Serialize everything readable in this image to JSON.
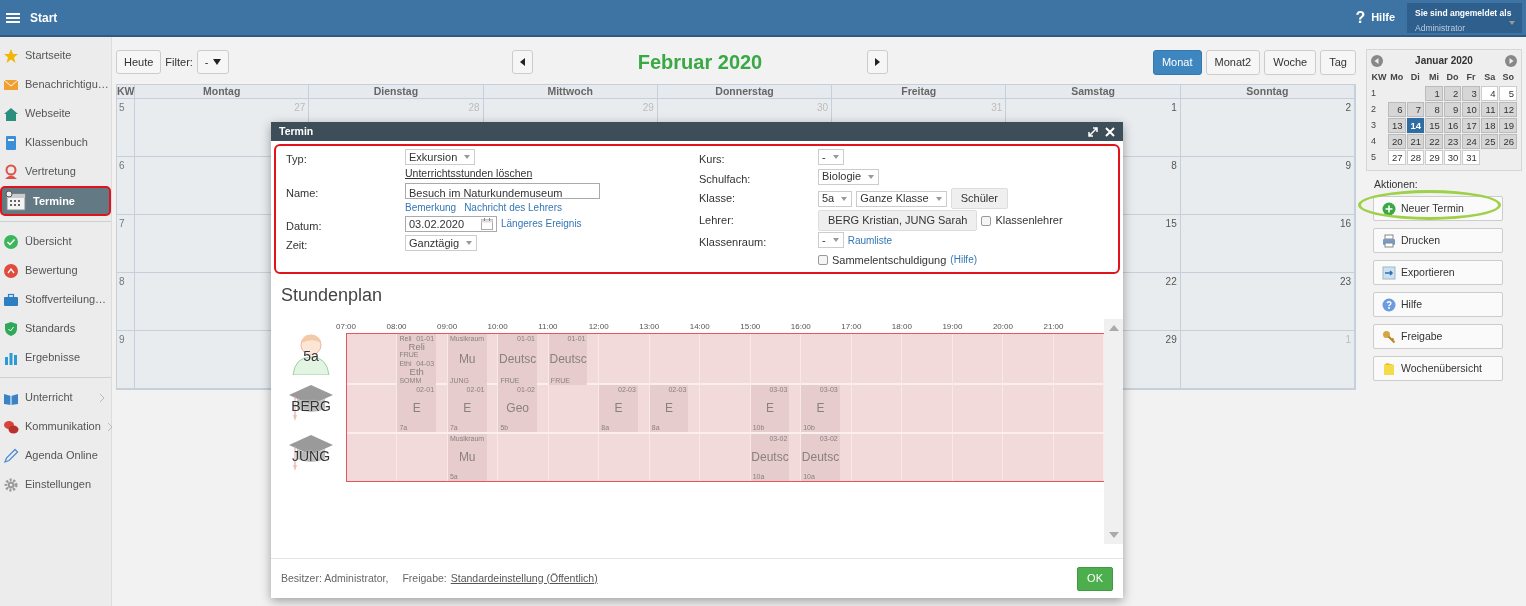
{
  "topbar": {
    "title": "Start",
    "help_glyph": "?",
    "help": "Hilfe",
    "login_label": "Sie sind angemeldet als",
    "user": "Administrator"
  },
  "sidebar": {
    "sections": [
      [
        {
          "label": "Startseite",
          "selected": false,
          "highlighted": false,
          "submenu": false
        },
        {
          "label": "Benachrichtigu…",
          "selected": false,
          "highlighted": false,
          "submenu": false
        },
        {
          "label": "Webseite",
          "selected": false,
          "highlighted": false,
          "submenu": false
        },
        {
          "label": "Klassenbuch",
          "selected": false,
          "highlighted": false,
          "submenu": false
        },
        {
          "label": "Vertretung",
          "selected": false,
          "highlighted": false,
          "submenu": false
        },
        {
          "label": "Termine",
          "selected": true,
          "highlighted": true,
          "submenu": false
        }
      ],
      [
        {
          "label": "Übersicht",
          "selected": false,
          "highlighted": false,
          "submenu": false
        },
        {
          "label": "Bewertung",
          "selected": false,
          "highlighted": false,
          "submenu": false
        },
        {
          "label": "Stoffverteilung…",
          "selected": false,
          "highlighted": false,
          "submenu": false
        },
        {
          "label": "Standards",
          "selected": false,
          "highlighted": false,
          "submenu": false
        },
        {
          "label": "Ergebnisse",
          "selected": false,
          "highlighted": false,
          "submenu": false
        }
      ],
      [
        {
          "label": "Unterricht",
          "selected": false,
          "highlighted": false,
          "submenu": true
        },
        {
          "label": "Kommunikation",
          "selected": false,
          "highlighted": false,
          "submenu": true
        },
        {
          "label": "Agenda Online",
          "selected": false,
          "highlighted": false,
          "submenu": false
        },
        {
          "label": "Einstellungen",
          "selected": false,
          "highlighted": false,
          "submenu": false
        }
      ]
    ]
  },
  "calendar": {
    "today": "Heute",
    "filter_label": "Filter:",
    "filter_value": "-",
    "title": "Februar 2020",
    "views": [
      {
        "label": "Monat",
        "selected": true
      },
      {
        "label": "Monat2",
        "selected": false
      },
      {
        "label": "Woche",
        "selected": false
      },
      {
        "label": "Tag",
        "selected": false
      }
    ],
    "columns": [
      "KW",
      "Montag",
      "Dienstag",
      "Mittwoch",
      "Donnerstag",
      "Freitag",
      "Samstag",
      "Sonntag"
    ],
    "weeks": [
      {
        "kw": "5",
        "days": [
          {
            "kind": "day",
            "date": "27",
            "muted": true
          },
          {
            "kind": "day",
            "date": "28",
            "muted": true
          },
          {
            "kind": "day",
            "date": "29",
            "muted": true
          },
          {
            "kind": "day",
            "date": "30",
            "muted": true
          },
          {
            "kind": "day",
            "date": "31",
            "muted": true
          },
          {
            "kind": "day",
            "date": "1",
            "muted": false
          },
          {
            "kind": "day",
            "date": "2",
            "muted": false
          }
        ]
      },
      {
        "kw": "6",
        "days": [
          {
            "kind": "hidden"
          },
          {
            "kind": "hidden"
          },
          {
            "kind": "hidden"
          },
          {
            "kind": "hidden"
          },
          {
            "kind": "hidden"
          },
          {
            "kind": "day",
            "date": "8",
            "muted": false
          },
          {
            "kind": "day",
            "date": "9",
            "muted": false
          }
        ]
      },
      {
        "kw": "7",
        "days": [
          {
            "kind": "hidden"
          },
          {
            "kind": "hidden"
          },
          {
            "kind": "hidden"
          },
          {
            "kind": "hidden"
          },
          {
            "kind": "hidden"
          },
          {
            "kind": "day",
            "date": "15",
            "muted": false
          },
          {
            "kind": "day",
            "date": "16",
            "muted": false
          }
        ]
      },
      {
        "kw": "8",
        "days": [
          {
            "kind": "hidden"
          },
          {
            "kind": "hidden"
          },
          {
            "kind": "hidden"
          },
          {
            "kind": "hidden"
          },
          {
            "kind": "hidden"
          },
          {
            "kind": "day",
            "date": "22",
            "muted": false
          },
          {
            "kind": "day",
            "date": "23",
            "muted": false
          }
        ]
      },
      {
        "kw": "9",
        "days": [
          {
            "kind": "hidden"
          },
          {
            "kind": "hidden"
          },
          {
            "kind": "hidden"
          },
          {
            "kind": "hidden"
          },
          {
            "kind": "hidden"
          },
          {
            "kind": "day",
            "date": "29",
            "muted": false
          },
          {
            "kind": "day",
            "date": "1",
            "muted": true
          }
        ]
      }
    ]
  },
  "mini_calendar": {
    "title": "Januar 2020",
    "columns": [
      "KW",
      "Mo",
      "Di",
      "Mi",
      "Do",
      "Fr",
      "Sa",
      "So"
    ],
    "weeks": [
      {
        "kw": "1",
        "days": [
          {
            "kind": "blank"
          },
          {
            "kind": "blank"
          },
          {
            "kind": "day",
            "date": "1",
            "shaded": true,
            "selected": false
          },
          {
            "kind": "day",
            "date": "2",
            "shaded": true,
            "selected": false
          },
          {
            "kind": "day",
            "date": "3",
            "shaded": true,
            "selected": false
          },
          {
            "kind": "day",
            "date": "4",
            "shaded": false,
            "selected": false
          },
          {
            "kind": "day",
            "date": "5",
            "shaded": false,
            "selected": false
          }
        ]
      },
      {
        "kw": "2",
        "days": [
          {
            "kind": "day",
            "date": "6",
            "shaded": true,
            "selected": false
          },
          {
            "kind": "day",
            "date": "7",
            "shaded": true,
            "selected": false
          },
          {
            "kind": "day",
            "date": "8",
            "shaded": true,
            "selected": false
          },
          {
            "kind": "day",
            "date": "9",
            "shaded": true,
            "selected": false
          },
          {
            "kind": "day",
            "date": "10",
            "shaded": true,
            "selected": false
          },
          {
            "kind": "day",
            "date": "11",
            "shaded": true,
            "selected": false
          },
          {
            "kind": "day",
            "date": "12",
            "shaded": true,
            "selected": false
          }
        ]
      },
      {
        "kw": "3",
        "days": [
          {
            "kind": "day",
            "date": "13",
            "shaded": true,
            "selected": false
          },
          {
            "kind": "day",
            "date": "14",
            "shaded": false,
            "selected": true
          },
          {
            "kind": "day",
            "date": "15",
            "shaded": true,
            "selected": false
          },
          {
            "kind": "day",
            "date": "16",
            "shaded": true,
            "selected": false
          },
          {
            "kind": "day",
            "date": "17",
            "shaded": true,
            "selected": false
          },
          {
            "kind": "day",
            "date": "18",
            "shaded": true,
            "selected": false
          },
          {
            "kind": "day",
            "date": "19",
            "shaded": true,
            "selected": false
          }
        ]
      },
      {
        "kw": "4",
        "days": [
          {
            "kind": "day",
            "date": "20",
            "shaded": true,
            "selected": false
          },
          {
            "kind": "day",
            "date": "21",
            "shaded": true,
            "selected": false
          },
          {
            "kind": "day",
            "date": "22",
            "shaded": true,
            "selected": false
          },
          {
            "kind": "day",
            "date": "23",
            "shaded": true,
            "selected": false
          },
          {
            "kind": "day",
            "date": "24",
            "shaded": true,
            "selected": false
          },
          {
            "kind": "day",
            "date": "25",
            "shaded": true,
            "selected": false
          },
          {
            "kind": "day",
            "date": "26",
            "shaded": true,
            "selected": false
          }
        ]
      },
      {
        "kw": "5",
        "days": [
          {
            "kind": "day",
            "date": "27",
            "shaded": false,
            "selected": false
          },
          {
            "kind": "day",
            "date": "28",
            "shaded": false,
            "selected": false
          },
          {
            "kind": "day",
            "date": "29",
            "shaded": false,
            "selected": false
          },
          {
            "kind": "day",
            "date": "30",
            "shaded": false,
            "selected": false
          },
          {
            "kind": "day",
            "date": "31",
            "shaded": false,
            "selected": false
          },
          {
            "kind": "blank"
          },
          {
            "kind": "blank"
          }
        ]
      }
    ]
  },
  "actions": {
    "label": "Aktionen:",
    "buttons": [
      {
        "label": "Neuer Termin",
        "highlighted": true
      },
      {
        "label": "Drucken",
        "highlighted": false
      },
      {
        "label": "Exportieren",
        "highlighted": false
      },
      {
        "label": "Hilfe",
        "highlighted": false
      },
      {
        "label": "Freigabe",
        "highlighted": false
      },
      {
        "label": "Wochenübersicht",
        "highlighted": false
      }
    ]
  },
  "dialog": {
    "title": "Termin",
    "form": {
      "highlighted": true,
      "left": [
        {
          "label": "Typ:",
          "controls": [
            {
              "kind": "select",
              "text": "Exkursion"
            }
          ],
          "below": [
            {
              "kind": "link_underlined",
              "text": "Unterrichtsstunden löschen"
            }
          ]
        },
        {
          "label": "Name:",
          "controls": [
            {
              "kind": "input",
              "text": "Besuch im Naturkundemuseum"
            }
          ],
          "below": [
            {
              "kind": "link",
              "text": "Bemerkung"
            },
            {
              "kind": "link",
              "text": "Nachricht des Lehrers"
            }
          ]
        },
        {
          "label": "Datum:",
          "controls": [
            {
              "kind": "date",
              "text": "03.02.2020"
            },
            {
              "kind": "link",
              "text": "Längeres Ereignis"
            }
          ]
        },
        {
          "label": "Zeit:",
          "controls": [
            {
              "kind": "select",
              "text": "Ganztägig"
            }
          ]
        }
      ],
      "right": [
        {
          "label": "Kurs:",
          "controls": [
            {
              "kind": "select",
              "text": "-"
            }
          ]
        },
        {
          "label": "Schulfach:",
          "controls": [
            {
              "kind": "select",
              "text": "Biologie"
            }
          ]
        },
        {
          "label": "Klasse:",
          "controls": [
            {
              "kind": "select",
              "text": "5a"
            },
            {
              "kind": "select",
              "text": "Ganze Klasse"
            },
            {
              "kind": "button",
              "text": "Schüler"
            }
          ]
        },
        {
          "label": "Lehrer:",
          "controls": [
            {
              "kind": "button",
              "text": "BERG Kristian, JUNG Sarah"
            },
            {
              "kind": "checkbox",
              "text": "Klassenlehrer",
              "checked": false
            }
          ]
        },
        {
          "label": "Klassenraum:",
          "controls": [
            {
              "kind": "select",
              "text": "-"
            },
            {
              "kind": "link",
              "text": "Raumliste"
            }
          ]
        },
        {
          "controls": [
            {
              "kind": "checkbox",
              "text": "Sammelentschuldigung",
              "checked": false
            },
            {
              "kind": "link",
              "text": "(Hilfe)"
            }
          ]
        }
      ]
    },
    "timetable": {
      "title": "Stundenplan",
      "hours": [
        "07:00",
        "08:00",
        "09:00",
        "10:00",
        "11:00",
        "12:00",
        "13:00",
        "14:00",
        "15:00",
        "16:00",
        "17:00",
        "18:00",
        "19:00",
        "20:00",
        "21:00"
      ],
      "rows": [
        {
          "label": "5a",
          "kind": "class",
          "slots": [
            {
              "kind": "empty"
            },
            {
              "kind": "split",
              "lessons": [
                {
                  "tag": "Reli",
                  "code": "01-01",
                  "subject": "Reli",
                  "note": "FRUE"
                },
                {
                  "tag": "Ethi",
                  "code": "04-03",
                  "subject": "Eth",
                  "note": "SOMM"
                }
              ]
            },
            {
              "kind": "lesson",
              "tag": "Musikraum",
              "subject": "Mu",
              "note": "JUNG"
            },
            {
              "kind": "lesson",
              "code": "01-01",
              "subject": "Deutsc",
              "note": "FRUE"
            },
            {
              "kind": "lesson",
              "code": "01-01",
              "subject": "Deutsc",
              "note": "FRUE"
            },
            {
              "kind": "empty"
            },
            {
              "kind": "empty"
            },
            {
              "kind": "empty"
            },
            {
              "kind": "empty"
            },
            {
              "kind": "empty"
            },
            {
              "kind": "empty"
            },
            {
              "kind": "empty"
            },
            {
              "kind": "empty"
            },
            {
              "kind": "empty"
            },
            {
              "kind": "empty"
            }
          ]
        },
        {
          "label": "BERG",
          "kind": "teacher",
          "slots": [
            {
              "kind": "empty"
            },
            {
              "kind": "lesson",
              "code": "02-01",
              "subject": "E",
              "note": "7a"
            },
            {
              "kind": "lesson",
              "code": "02-01",
              "subject": "E",
              "note": "7a"
            },
            {
              "kind": "lesson",
              "code": "01-02",
              "subject": "Geo",
              "note": "5b"
            },
            {
              "kind": "empty"
            },
            {
              "kind": "lesson",
              "code": "02-03",
              "subject": "E",
              "note": "8a"
            },
            {
              "kind": "lesson",
              "code": "02-03",
              "subject": "E",
              "note": "8a"
            },
            {
              "kind": "empty"
            },
            {
              "kind": "lesson",
              "code": "03-03",
              "subject": "E",
              "note": "10b"
            },
            {
              "kind": "lesson",
              "code": "03-03",
              "subject": "E",
              "note": "10b"
            },
            {
              "kind": "empty"
            },
            {
              "kind": "empty"
            },
            {
              "kind": "empty"
            },
            {
              "kind": "empty"
            },
            {
              "kind": "empty"
            }
          ]
        },
        {
          "label": "JUNG",
          "kind": "teacher",
          "slots": [
            {
              "kind": "empty"
            },
            {
              "kind": "empty"
            },
            {
              "kind": "lesson",
              "tag": "Musikraum",
              "subject": "Mu",
              "note": "5a"
            },
            {
              "kind": "empty"
            },
            {
              "kind": "empty"
            },
            {
              "kind": "empty"
            },
            {
              "kind": "empty"
            },
            {
              "kind": "empty"
            },
            {
              "kind": "lesson",
              "code": "03-02",
              "subject": "Deutsc",
              "note": "10a"
            },
            {
              "kind": "lesson",
              "code": "03-02",
              "subject": "Deutsc",
              "note": "10a"
            },
            {
              "kind": "empty"
            },
            {
              "kind": "empty"
            },
            {
              "kind": "empty"
            },
            {
              "kind": "empty"
            },
            {
              "kind": "empty"
            }
          ]
        }
      ]
    },
    "footer": {
      "owner": "Besitzer: Administrator,",
      "share_label": "Freigabe:",
      "share_link": "Standardeinstellung (Öffentlich)",
      "ok": "OK"
    }
  }
}
